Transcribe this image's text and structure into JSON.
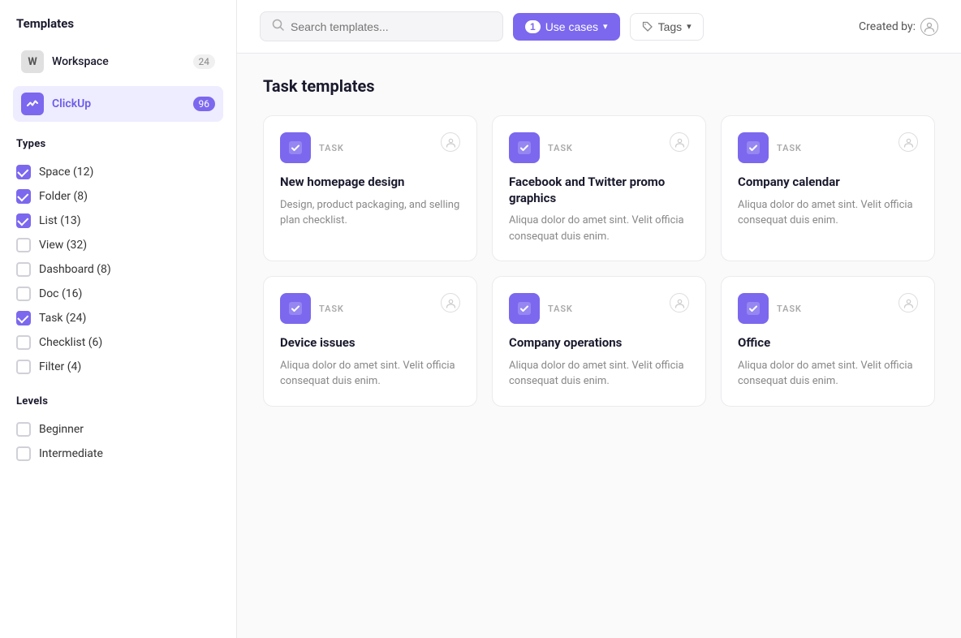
{
  "sidebar": {
    "title": "Templates",
    "sources": [
      {
        "id": "workspace",
        "icon_type": "workspace",
        "icon_text": "W",
        "label": "Workspace",
        "count": "24",
        "active": false
      },
      {
        "id": "clickup",
        "icon_type": "clickup",
        "icon_text": "✦",
        "label": "ClickUp",
        "count": "96",
        "active": true
      }
    ],
    "types_title": "Types",
    "types": [
      {
        "id": "space",
        "label": "Space (12)",
        "checked": true
      },
      {
        "id": "folder",
        "label": "Folder (8)",
        "checked": true
      },
      {
        "id": "list",
        "label": "List (13)",
        "checked": true
      },
      {
        "id": "view",
        "label": "View (32)",
        "checked": false
      },
      {
        "id": "dashboard",
        "label": "Dashboard (8)",
        "checked": false
      },
      {
        "id": "doc",
        "label": "Doc (16)",
        "checked": false
      },
      {
        "id": "task",
        "label": "Task (24)",
        "checked": true
      },
      {
        "id": "checklist",
        "label": "Checklist (6)",
        "checked": false
      },
      {
        "id": "filter",
        "label": "Filter (4)",
        "checked": false
      }
    ],
    "levels_title": "Levels",
    "levels": [
      {
        "id": "beginner",
        "label": "Beginner",
        "checked": false
      },
      {
        "id": "intermediate",
        "label": "Intermediate",
        "checked": false
      }
    ]
  },
  "topbar": {
    "search_placeholder": "Search templates...",
    "use_cases_badge": "1",
    "use_cases_label": "Use cases",
    "tags_label": "Tags",
    "created_by_label": "Created by:"
  },
  "main": {
    "section_title": "Task templates",
    "cards": [
      {
        "id": "card1",
        "tag": "TASK",
        "title": "New homepage design",
        "description": "Design, product packaging, and selling plan checklist."
      },
      {
        "id": "card2",
        "tag": "TASK",
        "title": "Facebook and Twitter promo graphics",
        "description": "Aliqua dolor do amet sint. Velit officia consequat duis enim."
      },
      {
        "id": "card3",
        "tag": "TASK",
        "title": "Company calendar",
        "description": "Aliqua dolor do amet sint. Velit officia consequat duis enim."
      },
      {
        "id": "card4",
        "tag": "TASK",
        "title": "Device issues",
        "description": "Aliqua dolor do amet sint. Velit officia consequat duis enim."
      },
      {
        "id": "card5",
        "tag": "TASK",
        "title": "Company operations",
        "description": "Aliqua dolor do amet sint. Velit officia consequat duis enim."
      },
      {
        "id": "card6",
        "tag": "TASK",
        "title": "Office",
        "description": "Aliqua dolor do amet sint. Velit officia consequat duis enim."
      }
    ]
  },
  "icons": {
    "search": "🔍",
    "chevron_down": "▾",
    "tag": "🏷",
    "person": "👤"
  }
}
